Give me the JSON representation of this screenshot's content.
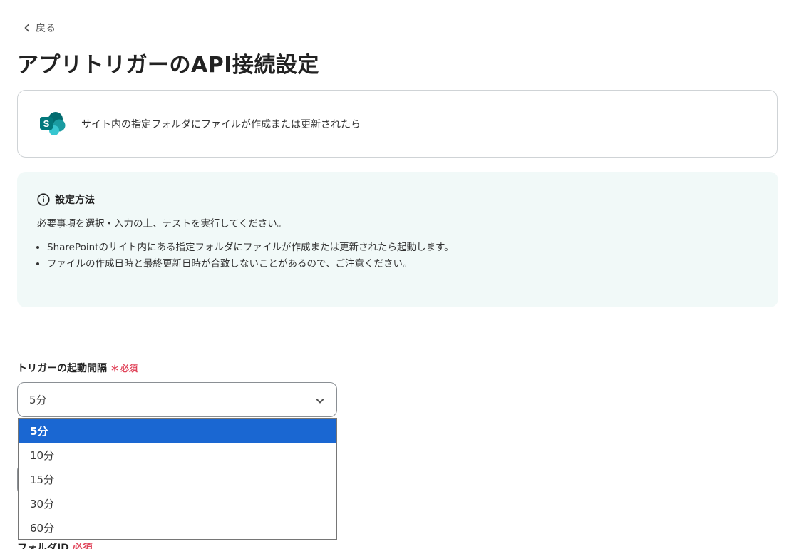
{
  "nav": {
    "back_label": "戻る"
  },
  "page": {
    "title": "アプリトリガーのAPI接続設定"
  },
  "trigger": {
    "app_icon": "sharepoint-logo",
    "text": "サイト内の指定フォルダにファイルが作成または更新されたら"
  },
  "info": {
    "icon": "info-icon",
    "title": "設定方法",
    "description": "必要事項を選択・入力の上、テストを実行してください。",
    "bullets": [
      "SharePointのサイト内にある指定フォルダにファイルが作成または更新されたら起動します。",
      "ファイルの作成日時と最終更新日時が合致しないことがあるので、ご注意ください。"
    ]
  },
  "interval_field": {
    "label": "トリガーの起動間隔",
    "required_mark": "＊",
    "required_label": "必須",
    "selected_value": "5分",
    "options": [
      "5分",
      "10分",
      "15分",
      "30分",
      "60分"
    ]
  },
  "next_field": {
    "label": "フォルダID",
    "required_label": "必須"
  },
  "colors": {
    "accent": "#1a67d2",
    "required": "#e0455b",
    "info_bg": "#f1f9f8"
  }
}
